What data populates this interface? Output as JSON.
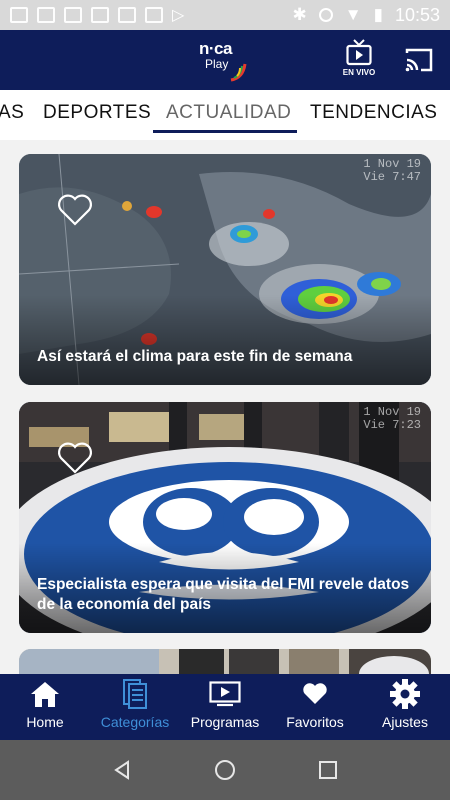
{
  "status_bar": {
    "time": "10:53",
    "left_icons": [
      "vpn-icon",
      "image-icon",
      "mail-icon",
      "mail-icon",
      "mail-icon",
      "gallery-icon",
      "play-store-icon"
    ],
    "right_icons": [
      "bluetooth-icon",
      "dnd-icon",
      "wifi-icon",
      "battery-icon"
    ]
  },
  "app_bar": {
    "logo_top": "n·ca",
    "logo_bottom": "Play",
    "live_label": "EN VIVO",
    "accent": "#0e1d5a"
  },
  "tabs": {
    "items": [
      {
        "label": "AS"
      },
      {
        "label": "DEPORTES"
      },
      {
        "label": "ACTUALIDAD"
      },
      {
        "label": "TENDENCIAS"
      }
    ],
    "active": "ACTUALIDAD"
  },
  "feed": {
    "cards": [
      {
        "title": "Así estará el clima para este fin de semana",
        "stamp_date": "1 Nov 19",
        "stamp_time": "Vie  7:47",
        "favorited": false
      },
      {
        "title": "Especialista espera que visita del FMI revele datos de la economía del país",
        "stamp_date": "1 Nov 19",
        "stamp_time": "Vie  7:23",
        "favorited": false
      }
    ]
  },
  "bottom_nav": {
    "items": [
      {
        "label": "Home",
        "icon": "home-icon"
      },
      {
        "label": "Categorías",
        "icon": "categories-icon"
      },
      {
        "label": "Programas",
        "icon": "programs-icon"
      },
      {
        "label": "Favoritos",
        "icon": "heart-icon"
      },
      {
        "label": "Ajustes",
        "icon": "gear-icon"
      }
    ],
    "active": "Categorías",
    "active_color": "#3f8fd8"
  }
}
